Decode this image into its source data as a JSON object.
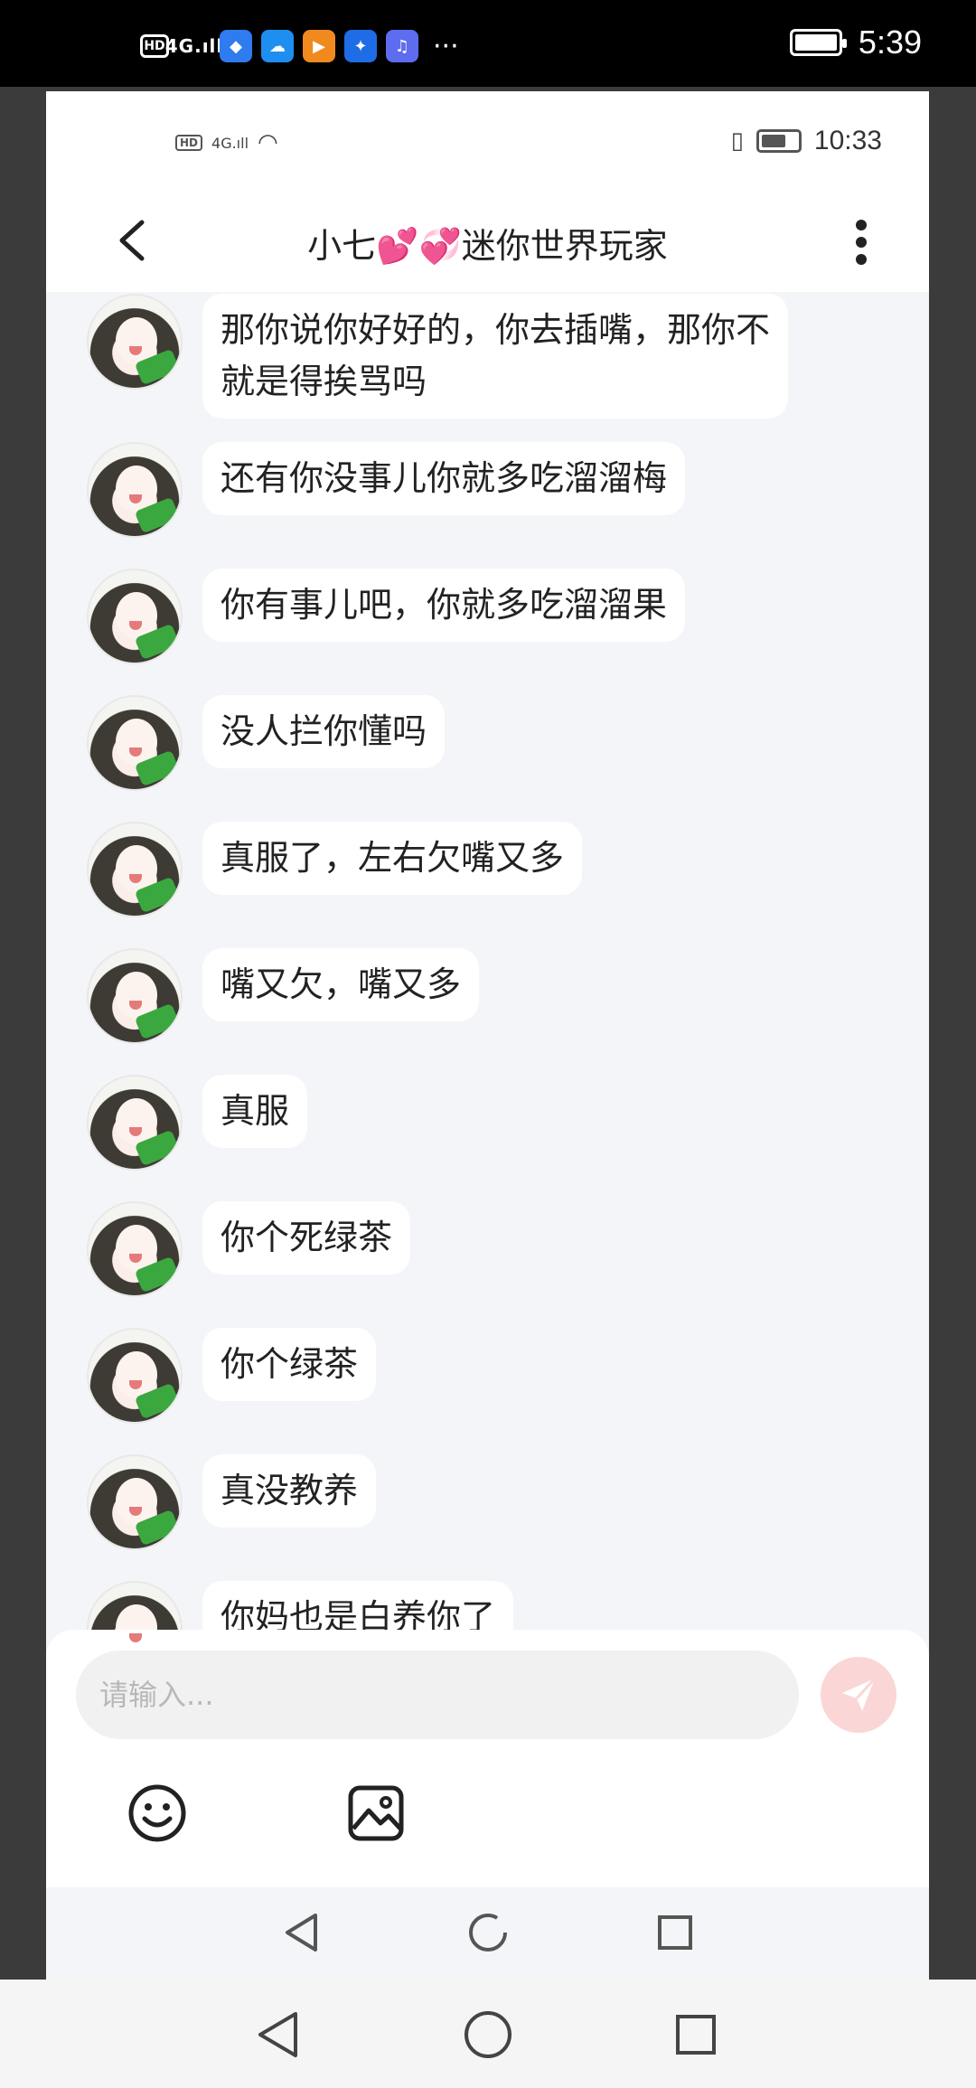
{
  "outer_status": {
    "time": "5:39",
    "network": "4G"
  },
  "inner_status": {
    "time": "10:33",
    "network": "4G"
  },
  "header": {
    "title": "小七💕💞迷你世界玩家"
  },
  "messages": [
    {
      "text": "那你说你好好的，你去插嘴，那你不就是得挨骂吗"
    },
    {
      "text": "还有你没事儿你就多吃溜溜梅"
    },
    {
      "text": "你有事儿吧，你就多吃溜溜果"
    },
    {
      "text": "没人拦你懂吗"
    },
    {
      "text": "真服了，左右欠嘴又多"
    },
    {
      "text": "嘴又欠，嘴又多"
    },
    {
      "text": "真服"
    },
    {
      "text": "你个死绿茶"
    },
    {
      "text": "你个绿茶"
    },
    {
      "text": "真没教养"
    },
    {
      "text": "你妈也是白养你了"
    }
  ],
  "composer": {
    "placeholder": "请输入..."
  },
  "icons": {
    "back": "chevron-left-icon",
    "more": "more-vertical-icon",
    "send": "send-icon",
    "emoji": "emoji-icon",
    "image": "image-icon"
  },
  "colors": {
    "send_button": "#fbd6d6",
    "background": "#f4f5f8",
    "bubble": "#ffffff"
  }
}
